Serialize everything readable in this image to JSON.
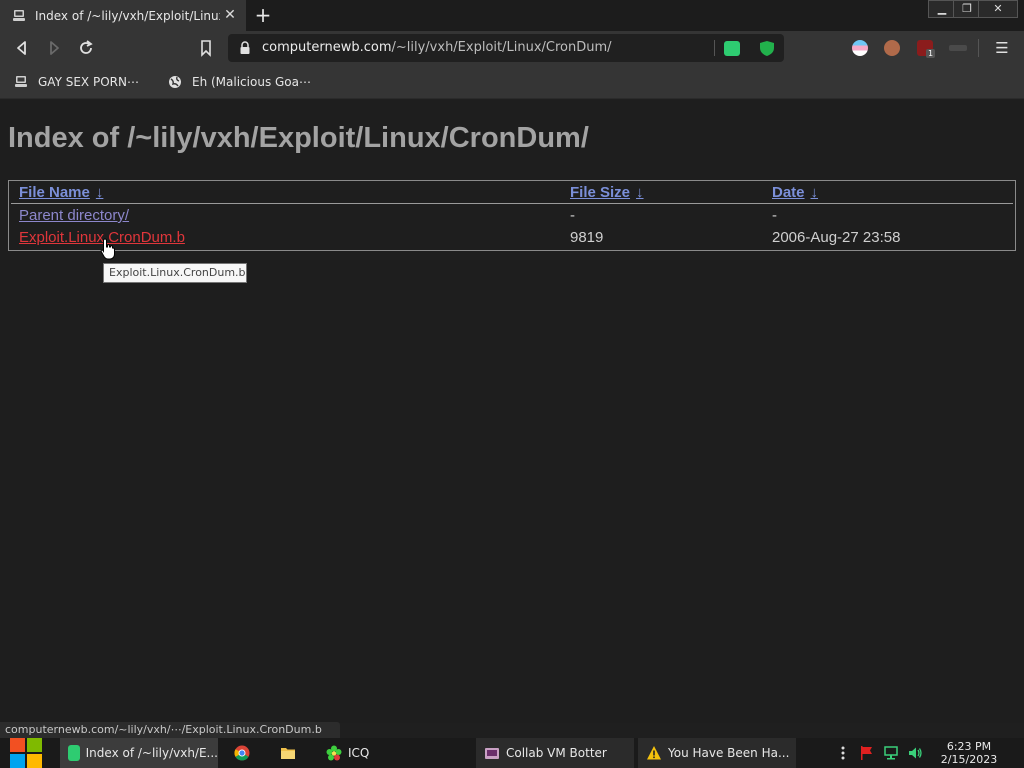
{
  "browser": {
    "tab": {
      "title": "Index of /~lily/vxh/Exploit/Linux/C",
      "close_symbol": "✕"
    },
    "new_tab_symbol": "+",
    "window_controls": {
      "minimize": "▁",
      "maximize": "❐",
      "close": "✕"
    },
    "address": {
      "host": "computernewb.com",
      "path": "/~lily/vxh/Exploit/Linux/CronDum/"
    },
    "menu_symbol": "☰",
    "extension_badge": "1"
  },
  "bookmarks": [
    {
      "label": "GAY SEX PORN⋯",
      "icon": "site-icon"
    },
    {
      "label": "Eh (Malicious Goa⋯",
      "icon": "globe-icon"
    }
  ],
  "page": {
    "heading": "Index of /~lily/vxh/Exploit/Linux/CronDum/",
    "columns": {
      "name": "File Name",
      "size": "File Size",
      "date": "Date",
      "sort_arrow": "↓"
    },
    "rows": [
      {
        "name": "Parent directory/",
        "size": "-",
        "date": "-"
      },
      {
        "name": "Exploit.Linux.CronDum.b",
        "size": "9819",
        "date": "2006-Aug-27 23:58"
      }
    ],
    "tooltip": "Exploit.Linux.CronDum.b"
  },
  "status_bar": "computernewb.com/~lily/vxh/⋯/Exploit.Linux.CronDum.b",
  "taskbar": {
    "items": [
      {
        "label": "Index of /~lily/vxh/E...",
        "icon": "browser-icon"
      },
      {
        "label": "",
        "icon": "chrome-icon"
      },
      {
        "label": "",
        "icon": "folder-icon"
      },
      {
        "label": "ICQ",
        "icon": "icq-flower-icon"
      },
      {
        "label": "Collab VM Botter",
        "icon": "app-icon"
      },
      {
        "label": "You Have Been Ha...",
        "icon": "warning-icon"
      }
    ],
    "clock": {
      "time": "6:23 PM",
      "date": "2/15/2023"
    }
  },
  "colors": {
    "page_bg": "#1e1e1e",
    "heading": "#a3a3a3",
    "header_link": "#7b8fd9",
    "visited_link": "#8d87cc",
    "hover_link": "#e0363b",
    "chrome_bg": "#353535"
  }
}
